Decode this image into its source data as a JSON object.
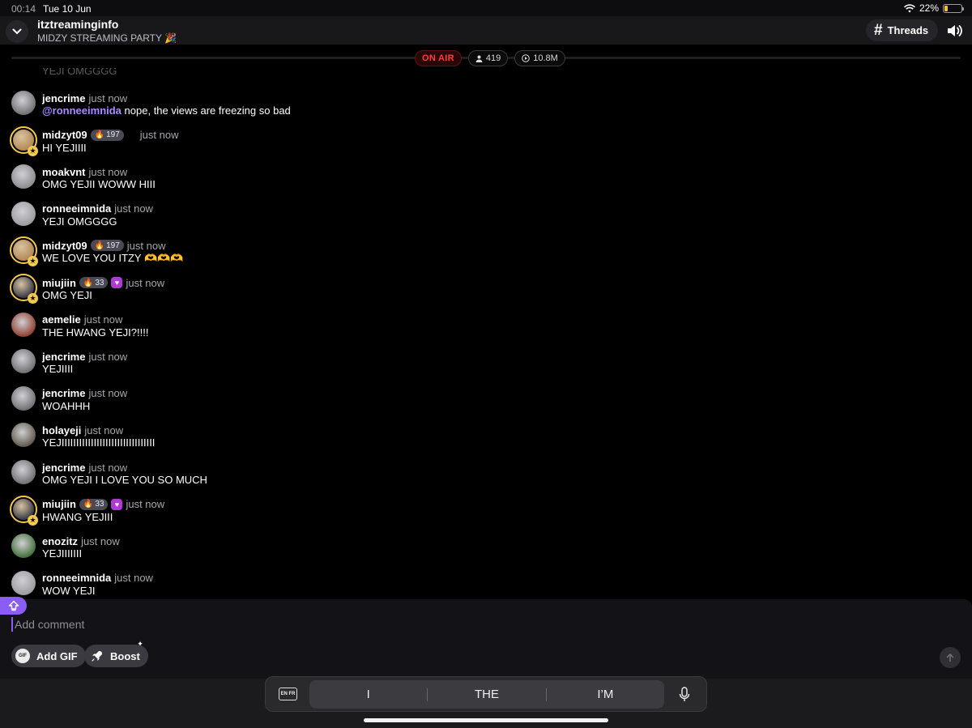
{
  "status_bar": {
    "time": "00:14",
    "date": "Tue 10 Jun",
    "battery": "22%",
    "battery_level": 0.22
  },
  "header": {
    "channel": "itztreaminginfo",
    "subtitle": "MIDZY STREAMING PARTY 🎉",
    "threads_label": "Threads"
  },
  "stream_stats": {
    "on_air": "ON AIR",
    "viewers": "419",
    "views": "10.8M"
  },
  "chat": {
    "partial_top": "YEJI OMGGGG",
    "messages": [
      {
        "user": "jencrime",
        "time": "just now",
        "mention": "@ronneeimnida",
        "text": "nope, the views are freezing so bad",
        "avatar": "#6c6c70"
      },
      {
        "user": "midzyt09",
        "fire": "197",
        "time": "just now",
        "text": "HI YEJIIII",
        "ring": true,
        "avatar": "#b48a58"
      },
      {
        "user": "moakvnt",
        "time": "just now",
        "text": "OMG YEJII WOWW HIII",
        "avatar": "#8a8a8e"
      },
      {
        "user": "ronneeimnida",
        "time": "just now",
        "text": "YEJI OMGGGG",
        "avatar": "#9a9a9e"
      },
      {
        "user": "midzyt09",
        "fire": "197",
        "time": "just now",
        "text": "WE LOVE YOU ITZY 🫶🫶🫶",
        "ring": true,
        "avatar": "#b48a58"
      },
      {
        "user": "miujiin",
        "fire": "33",
        "heart": true,
        "time": "just now",
        "text": "OMG YEJI",
        "ring": true,
        "avatar": "#3d3d48"
      },
      {
        "user": "aemelie",
        "time": "just now",
        "text": "THE HWANG YEJI?!!!!",
        "avatar": "#8c3a2a"
      },
      {
        "user": "jencrime",
        "time": "just now",
        "text": "YEJIIII",
        "avatar": "#6c6c70"
      },
      {
        "user": "jencrime",
        "time": "just now",
        "text": "WOAHHH",
        "avatar": "#6c6c70"
      },
      {
        "user": "holayeji",
        "time": "just now",
        "text": "YEJIIIIIIIIIIIIIIIIIIIIIIIIIIIIIIII",
        "avatar": "#5b5446"
      },
      {
        "user": "jencrime",
        "time": "just now",
        "text": "OMG YEJI I LOVE YOU SO MUCH",
        "avatar": "#6c6c70"
      },
      {
        "user": "miujiin",
        "fire": "33",
        "heart": true,
        "time": "just now",
        "text": "HWANG YEJIII",
        "ring": true,
        "avatar": "#3d3d48"
      },
      {
        "user": "enozitz",
        "time": "just now",
        "text": "YEJIIIIIII",
        "avatar": "#3e6b35"
      },
      {
        "user": "ronneeimnida",
        "time": "just now",
        "text": "WOW YEJI",
        "avatar": "#9a9a9e"
      }
    ]
  },
  "composer": {
    "placeholder": "Add comment",
    "gif_label": "Add GIF",
    "gif_icon_text": "GIF",
    "boost_label": "Boost"
  },
  "keyboard": {
    "lang": "EN FR",
    "suggestions": [
      "I",
      "THE",
      "I’M"
    ]
  },
  "icons": {
    "back": "chevron-down-icon",
    "threads": "hash-icon",
    "volume": "speaker-icon",
    "viewers": "person-icon",
    "views": "play-circle-icon",
    "fire": "fire-icon",
    "star": "star-icon",
    "heart": "heart-badge-icon",
    "boost": "rocket-icon",
    "send": "arrow-up-icon",
    "mic": "mic-icon",
    "upgrade": "upgrade-icon"
  },
  "colors": {
    "accent": "#8b5cf6",
    "on_air": "#ff3b3b",
    "ring": "#f2c94c",
    "mention": "#a98bff"
  }
}
